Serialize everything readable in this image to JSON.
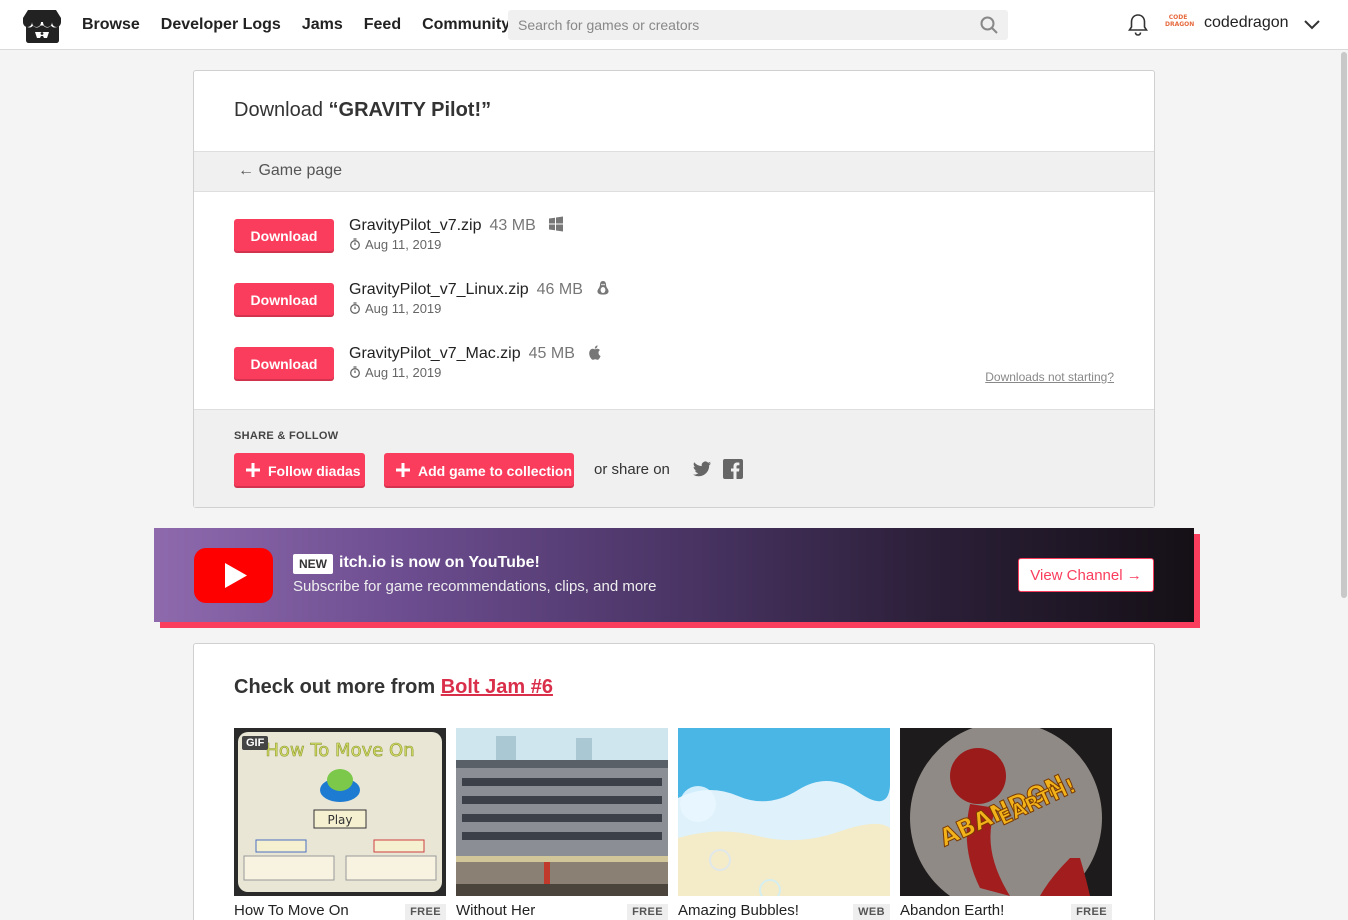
{
  "header": {
    "nav": [
      "Browse",
      "Developer Logs",
      "Jams",
      "Feed",
      "Community"
    ],
    "search_placeholder": "Search for games or creators",
    "username": "codedragon",
    "avatar_text": "CODE DRAGON"
  },
  "download": {
    "title_prefix": "Download ",
    "game_name_quoted": "“GRAVITY Pilot!”",
    "game_page_link": "← Game page",
    "button_label": "Download",
    "files": [
      {
        "name": "GravityPilot_v7.zip",
        "size": "43 MB",
        "platform": "windows-icon",
        "date": "Aug 11, 2019"
      },
      {
        "name": "GravityPilot_v7_Linux.zip",
        "size": "46 MB",
        "platform": "linux-icon",
        "date": "Aug 11, 2019"
      },
      {
        "name": "GravityPilot_v7_Mac.zip",
        "size": "45 MB",
        "platform": "apple-icon",
        "date": "Aug 11, 2019"
      }
    ],
    "not_starting": "Downloads not starting?"
  },
  "share": {
    "label": "SHARE & FOLLOW",
    "follow": "Follow diadas",
    "add_collection": "Add game to collection",
    "or_share": "or share on"
  },
  "youtube": {
    "new_tag": "NEW",
    "title": "itch.io is now on YouTube!",
    "subtitle": "Subscribe for game recommendations, clips, and more",
    "cta": "View Channel →"
  },
  "jam": {
    "heading_prefix": "Check out more from ",
    "jam_name": "Bolt Jam #6",
    "games": [
      {
        "title": "How To Move On",
        "tag": "FREE",
        "gif": "GIF"
      },
      {
        "title": "Without Her",
        "tag": "FREE"
      },
      {
        "title": "Amazing Bubbles!",
        "tag": "WEB"
      },
      {
        "title": "Abandon Earth!",
        "tag": "FREE"
      }
    ]
  },
  "colors": {
    "accent": "#fa3d5d",
    "link": "#da2f4a"
  }
}
